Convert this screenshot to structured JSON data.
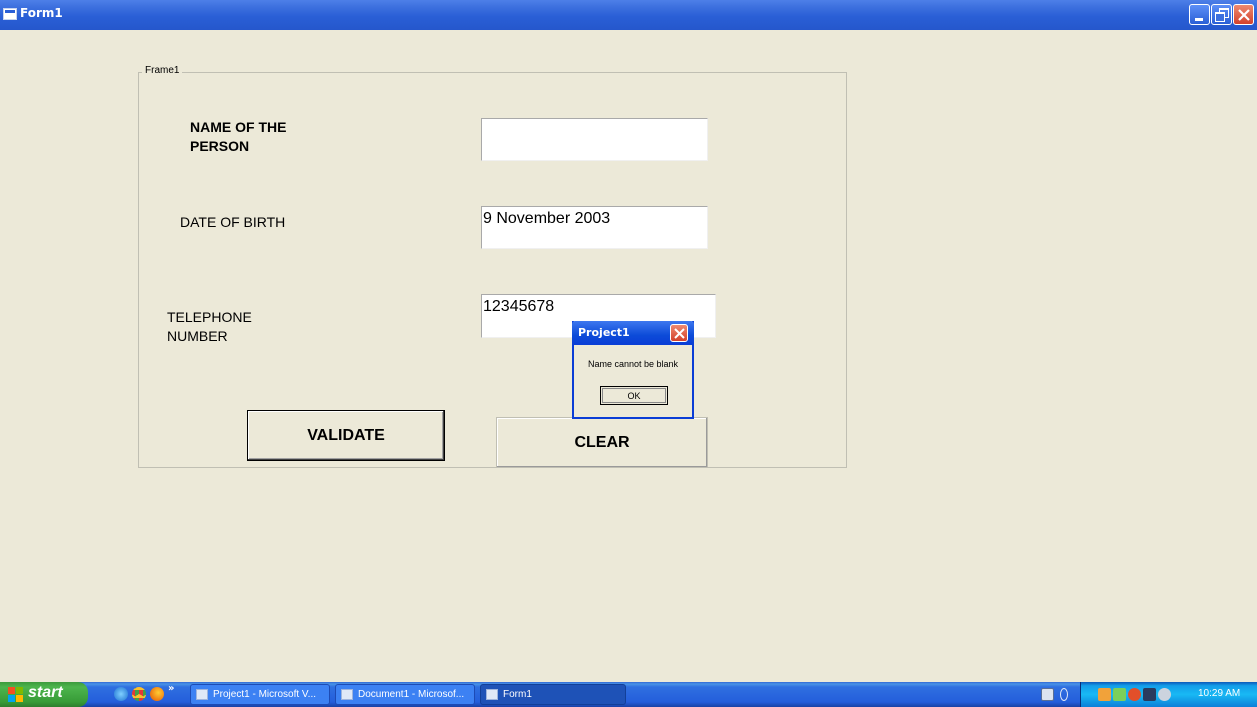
{
  "window": {
    "title": "Form1",
    "icon": "form-icon"
  },
  "frame": {
    "caption": "Frame1"
  },
  "form": {
    "name_label_line1": "NAME OF THE",
    "name_label_line2": "PERSON",
    "name_value": "",
    "dob_label": "DATE OF BIRTH",
    "dob_value": "9 November 2003",
    "phone_label_line1": "TELEPHONE",
    "phone_label_line2": "NUMBER",
    "phone_value": "12345678",
    "validate_label": "VALIDATE",
    "clear_label": "CLEAR"
  },
  "dialog": {
    "title": "Project1",
    "message": "Name cannot be blank",
    "ok_label": "OK"
  },
  "taskbar": {
    "start_label": "start",
    "overflow": "»",
    "tasks": [
      {
        "label": "Project1 - Microsoft V...",
        "active": false
      },
      {
        "label": "Document1 - Microsof...",
        "active": false
      },
      {
        "label": "Form1",
        "active": true
      }
    ],
    "clock": "10:29 AM"
  },
  "colors": {
    "desktop_bg": "#ece9d8",
    "titlebar": "#2a5fd6",
    "taskbar": "#245edb",
    "start": "#379b37"
  }
}
